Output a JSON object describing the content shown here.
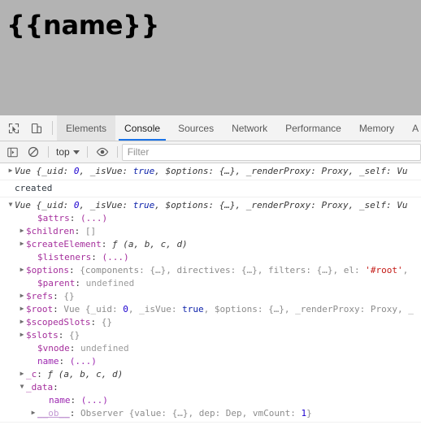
{
  "page": {
    "heading": "{{name}}",
    "background_color": "#b3b3b3"
  },
  "devtools": {
    "accent_color": "#1a73e8",
    "toolbar_buttons": [
      {
        "name": "inspect-element-icon",
        "title": "Inspect"
      },
      {
        "name": "device-toolbar-icon",
        "title": "Toggle device toolbar"
      }
    ],
    "tabs": [
      {
        "label": "Elements",
        "active": false,
        "hovered": true
      },
      {
        "label": "Console",
        "active": true,
        "hovered": false
      },
      {
        "label": "Sources",
        "active": false,
        "hovered": false
      },
      {
        "label": "Network",
        "active": false,
        "hovered": false
      },
      {
        "label": "Performance",
        "active": false,
        "hovered": false
      },
      {
        "label": "Memory",
        "active": false,
        "hovered": false
      },
      {
        "label": "A",
        "active": false,
        "hovered": false
      }
    ],
    "console_toolbar": {
      "sidebar_toggle": "console-sidebar-icon",
      "clear_console": "clear-console-icon",
      "context_label": "top",
      "eye_icon": "create-live-expression-icon",
      "filter_placeholder": "Filter",
      "filter_value": ""
    }
  },
  "console_messages": [
    {
      "id": "msg-vue-collapsed",
      "expanded": false,
      "lines": [
        {
          "indent": 0,
          "triangle": "collapsed",
          "tokens": [
            {
              "text": "Vue ",
              "cls": "t-obj"
            },
            {
              "text": "{_uid: ",
              "cls": "t-obj"
            },
            {
              "text": "0",
              "cls": "t-num t-ital"
            },
            {
              "text": ", _isVue: ",
              "cls": "t-obj"
            },
            {
              "text": "true",
              "cls": "t-bool t-ital"
            },
            {
              "text": ", $options: {…}, _renderProxy: Proxy, _self: Vu",
              "cls": "t-obj"
            }
          ]
        }
      ]
    },
    {
      "id": "msg-created",
      "expanded": false,
      "lines": [
        {
          "indent": 0,
          "triangle": "none",
          "tokens": [
            {
              "text": "created",
              "cls": "t-plain"
            }
          ]
        }
      ]
    },
    {
      "id": "msg-vue-expanded",
      "expanded": true,
      "lines": [
        {
          "indent": 0,
          "triangle": "expanded",
          "tokens": [
            {
              "text": "Vue ",
              "cls": "t-obj"
            },
            {
              "text": "{_uid: ",
              "cls": "t-obj"
            },
            {
              "text": "0",
              "cls": "t-num t-ital"
            },
            {
              "text": ", _isVue: ",
              "cls": "t-obj"
            },
            {
              "text": "true",
              "cls": "t-bool t-ital"
            },
            {
              "text": ", $options: {…}, _renderProxy: Proxy, _self: Vu",
              "cls": "t-obj"
            }
          ]
        },
        {
          "indent": 2,
          "triangle": "none",
          "tokens": [
            {
              "text": "$attrs",
              "cls": "t-prop"
            },
            {
              "text": ": ",
              "cls": "t-punct"
            },
            {
              "text": "(...)",
              "cls": "t-prop"
            }
          ]
        },
        {
          "indent": 1,
          "triangle": "collapsed",
          "tokens": [
            {
              "text": "$children",
              "cls": "t-prop"
            },
            {
              "text": ": ",
              "cls": "t-punct"
            },
            {
              "text": "[]",
              "cls": "t-dim"
            }
          ]
        },
        {
          "indent": 1,
          "triangle": "collapsed",
          "tokens": [
            {
              "text": "$createElement",
              "cls": "t-prop"
            },
            {
              "text": ": ",
              "cls": "t-punct"
            },
            {
              "text": "ƒ (a, b, c, d)",
              "cls": "t-fn"
            }
          ]
        },
        {
          "indent": 2,
          "triangle": "none",
          "tokens": [
            {
              "text": "$listeners",
              "cls": "t-prop"
            },
            {
              "text": ": ",
              "cls": "t-punct"
            },
            {
              "text": "(...)",
              "cls": "t-prop"
            }
          ]
        },
        {
          "indent": 1,
          "triangle": "collapsed",
          "tokens": [
            {
              "text": "$options",
              "cls": "t-prop"
            },
            {
              "text": ": ",
              "cls": "t-punct"
            },
            {
              "text": "{components: {…}, directives: {…}, filters: {…}, el: ",
              "cls": "t-dim"
            },
            {
              "text": "'#root'",
              "cls": "t-str"
            },
            {
              "text": ",",
              "cls": "t-dim"
            }
          ]
        },
        {
          "indent": 2,
          "triangle": "none",
          "tokens": [
            {
              "text": "$parent",
              "cls": "t-prop"
            },
            {
              "text": ": ",
              "cls": "t-punct"
            },
            {
              "text": "undefined",
              "cls": "t-undef"
            }
          ]
        },
        {
          "indent": 1,
          "triangle": "collapsed",
          "tokens": [
            {
              "text": "$refs",
              "cls": "t-prop"
            },
            {
              "text": ": ",
              "cls": "t-punct"
            },
            {
              "text": "{}",
              "cls": "t-dim"
            }
          ]
        },
        {
          "indent": 1,
          "triangle": "collapsed",
          "tokens": [
            {
              "text": "$root",
              "cls": "t-prop"
            },
            {
              "text": ": ",
              "cls": "t-punct"
            },
            {
              "text": "Vue {_uid: ",
              "cls": "t-dim"
            },
            {
              "text": "0",
              "cls": "t-num"
            },
            {
              "text": ", _isVue: ",
              "cls": "t-dim"
            },
            {
              "text": "true",
              "cls": "t-bool"
            },
            {
              "text": ", $options: {…}, _renderProxy: Proxy, _",
              "cls": "t-dim"
            }
          ]
        },
        {
          "indent": 1,
          "triangle": "collapsed",
          "tokens": [
            {
              "text": "$scopedSlots",
              "cls": "t-prop"
            },
            {
              "text": ": ",
              "cls": "t-punct"
            },
            {
              "text": "{}",
              "cls": "t-dim"
            }
          ]
        },
        {
          "indent": 1,
          "triangle": "collapsed",
          "tokens": [
            {
              "text": "$slots",
              "cls": "t-prop"
            },
            {
              "text": ": ",
              "cls": "t-punct"
            },
            {
              "text": "{}",
              "cls": "t-dim"
            }
          ]
        },
        {
          "indent": 2,
          "triangle": "none",
          "tokens": [
            {
              "text": "$vnode",
              "cls": "t-prop"
            },
            {
              "text": ": ",
              "cls": "t-punct"
            },
            {
              "text": "undefined",
              "cls": "t-undef"
            }
          ]
        },
        {
          "indent": 2,
          "triangle": "none",
          "tokens": [
            {
              "text": "name",
              "cls": "t-name"
            },
            {
              "text": ": ",
              "cls": "t-punct"
            },
            {
              "text": "(...)",
              "cls": "t-name"
            }
          ]
        },
        {
          "indent": 1,
          "triangle": "collapsed",
          "tokens": [
            {
              "text": "_c",
              "cls": "t-prop"
            },
            {
              "text": ": ",
              "cls": "t-punct"
            },
            {
              "text": "ƒ (a, b, c, d)",
              "cls": "t-fn"
            }
          ]
        },
        {
          "indent": 1,
          "triangle": "expanded",
          "tokens": [
            {
              "text": "_data",
              "cls": "t-prop"
            },
            {
              "text": ":",
              "cls": "t-punct"
            }
          ]
        },
        {
          "indent": 3,
          "triangle": "none",
          "tokens": [
            {
              "text": "name",
              "cls": "t-name"
            },
            {
              "text": ": ",
              "cls": "t-punct"
            },
            {
              "text": "(...)",
              "cls": "t-name"
            }
          ]
        },
        {
          "indent": 2,
          "triangle": "collapsed",
          "tokens": [
            {
              "text": "__ob__",
              "cls": "t-nonenum"
            },
            {
              "text": ": ",
              "cls": "t-punct"
            },
            {
              "text": "Observer {value: {…}, dep: Dep, vmCount: ",
              "cls": "t-dim"
            },
            {
              "text": "1",
              "cls": "t-num"
            },
            {
              "text": "}",
              "cls": "t-dim"
            }
          ]
        }
      ]
    }
  ]
}
